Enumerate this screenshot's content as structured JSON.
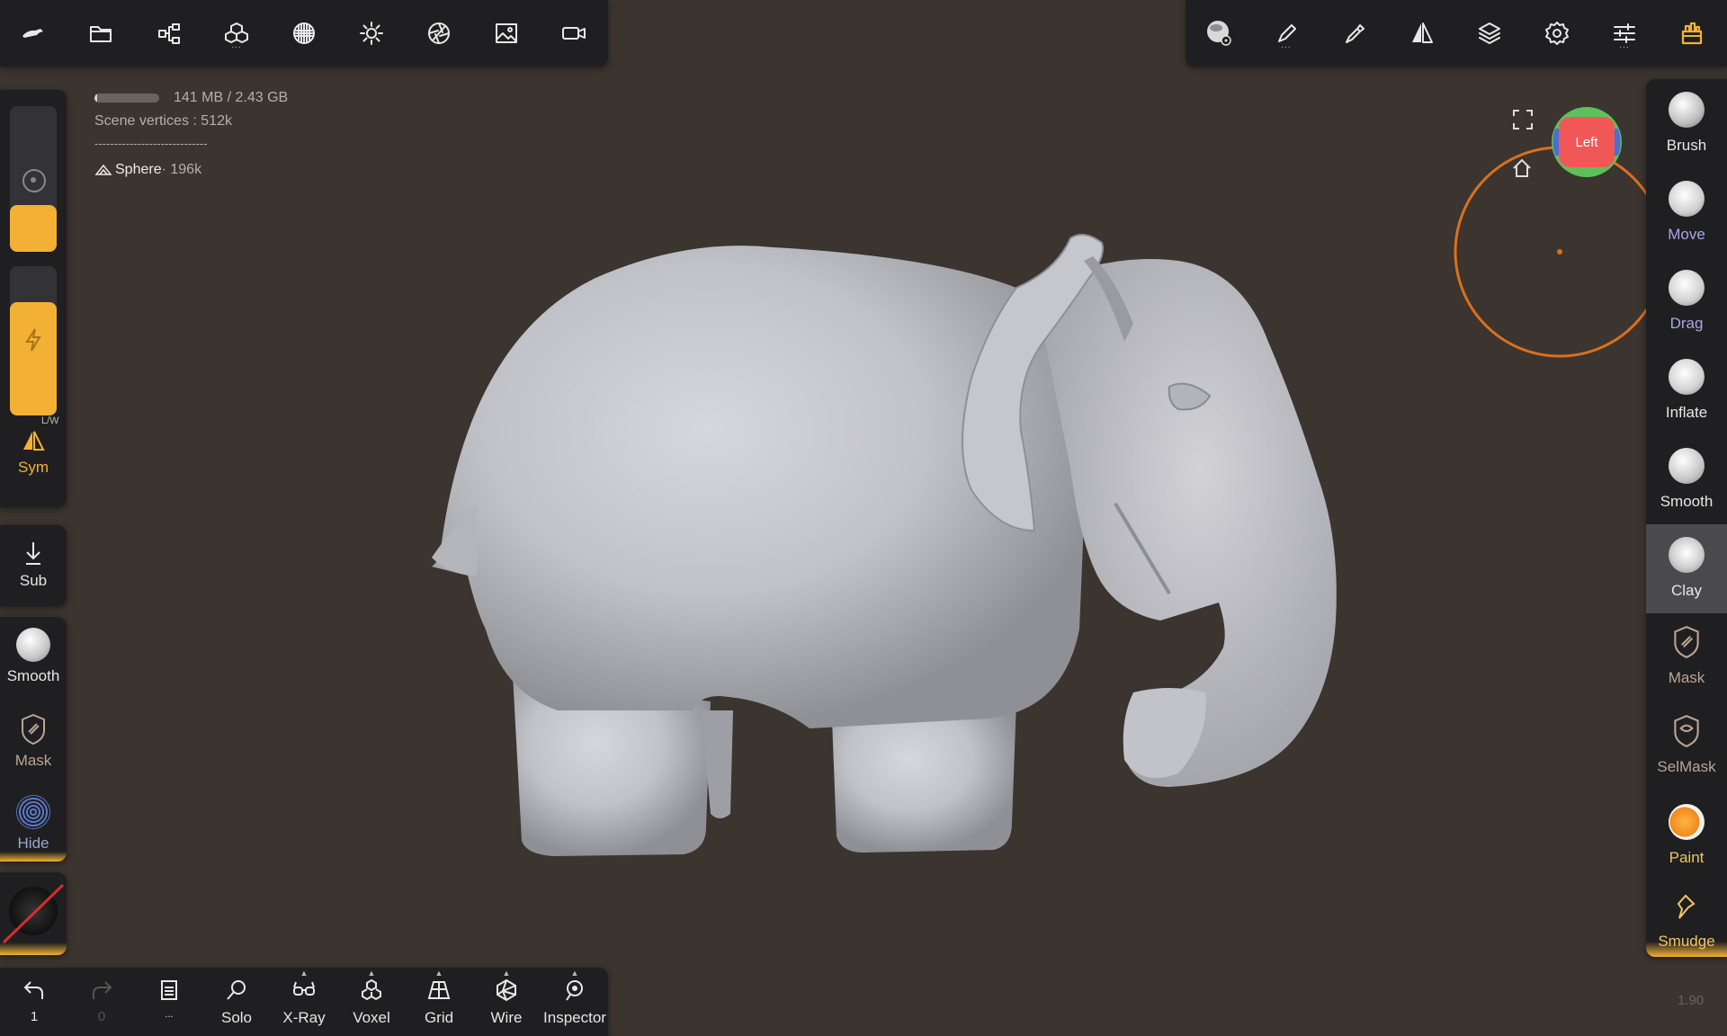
{
  "top_left_toolbar": {
    "items": [
      {
        "icon": "app-logo-icon"
      },
      {
        "icon": "folder-icon"
      },
      {
        "icon": "scene-graph-icon"
      },
      {
        "icon": "primitives-icon",
        "has_more": true
      },
      {
        "icon": "material-sphere-icon"
      },
      {
        "icon": "light-sun-icon"
      },
      {
        "icon": "camera-aperture-icon"
      },
      {
        "icon": "image-icon"
      },
      {
        "icon": "video-camera-icon"
      }
    ],
    "more_dots": "..."
  },
  "top_right_toolbar": {
    "items": [
      {
        "icon": "material-settings-icon"
      },
      {
        "icon": "brush-pen-icon",
        "has_more": true
      },
      {
        "icon": "picker-icon"
      },
      {
        "icon": "symmetry-icon"
      },
      {
        "icon": "layers-icon"
      },
      {
        "icon": "settings-gear-icon"
      },
      {
        "icon": "sliders-icon",
        "has_more": true
      },
      {
        "icon": "tools-toggle-icon"
      }
    ],
    "more_dots": "..."
  },
  "info": {
    "memory_text": "141 MB / 2.43 GB",
    "memory_fraction": 0.04,
    "vertices_text": "Scene vertices :  512k",
    "separator": "-----------------------------",
    "object_name": "Sphere",
    "object_count": " · 196k"
  },
  "view": {
    "view_cube_label": "Left",
    "canvas_color": "#3b342f"
  },
  "left_toolbar": {
    "sym_label": "Sym",
    "sym_mode": "L/W",
    "sub_label": "Sub",
    "smooth_label": "Smooth",
    "mask_label": "Mask",
    "hide_label": "Hide"
  },
  "right_tools": [
    {
      "label": "Brush",
      "color": "#e6e6e6",
      "active": false
    },
    {
      "label": "Move",
      "color": "#a9a6e8",
      "active": false
    },
    {
      "label": "Drag",
      "color": "#a9a6e8",
      "active": false
    },
    {
      "label": "Inflate",
      "color": "#e6e6e6",
      "active": false
    },
    {
      "label": "Smooth",
      "color": "#e6e6e6",
      "active": false
    },
    {
      "label": "Clay",
      "color": "#e6e6e6",
      "active": true
    },
    {
      "label": "Mask",
      "color": "#b9a593",
      "active": false
    },
    {
      "label": "SelMask",
      "color": "#b9a593",
      "active": false
    },
    {
      "label": "Paint",
      "color": "#f0c660",
      "active": false
    },
    {
      "label": "Smudge",
      "color": "#f0c660",
      "active": false
    }
  ],
  "bottom_toolbar": {
    "undo_count": "1",
    "redo_count": "0",
    "more_dots": "...",
    "items": [
      "Solo",
      "X-Ray",
      "Voxel",
      "Grid",
      "Wire",
      "Inspector"
    ]
  },
  "version": "1.90",
  "colors": {
    "accent": "#f2b134",
    "panel": "#1f1f21",
    "orange_circle": "#d9701e"
  }
}
